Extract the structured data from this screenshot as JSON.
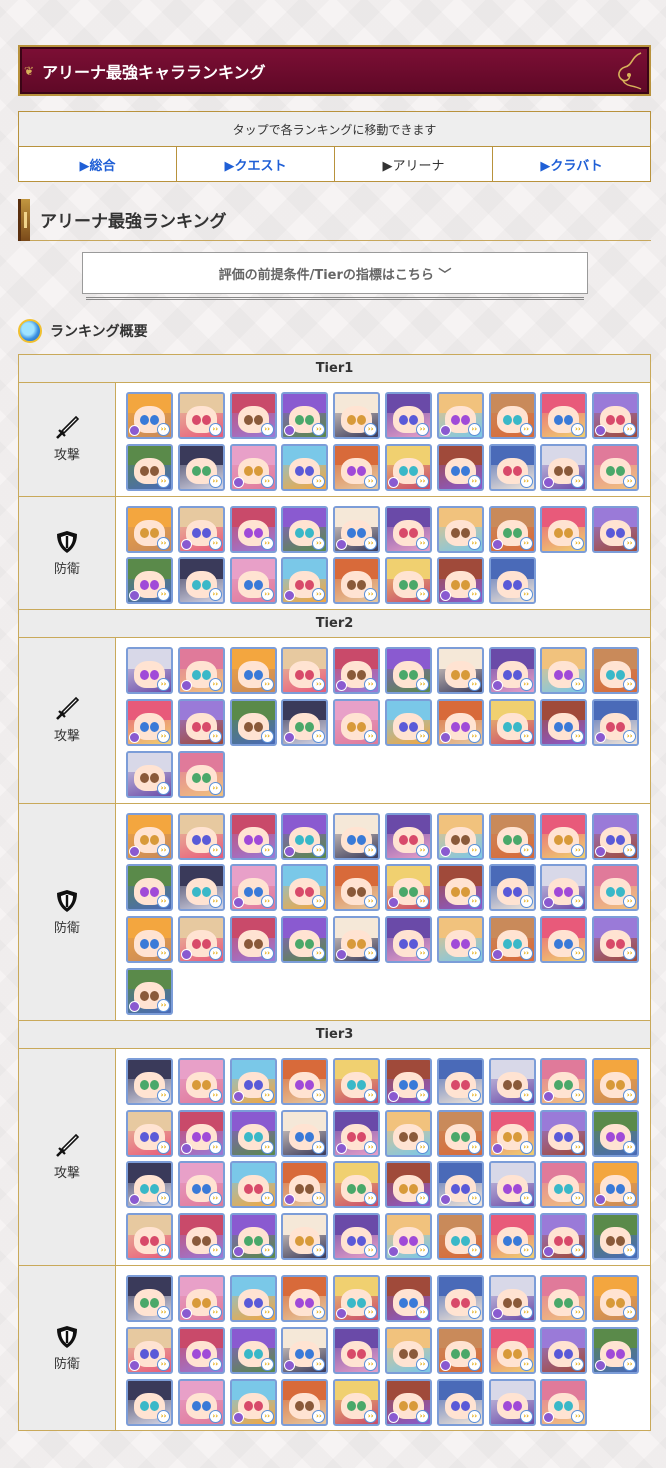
{
  "banner": {
    "title": "アリーナ最強キャラランキング"
  },
  "nav": {
    "header": "タップで各ランキングに移動できます",
    "tabs": [
      {
        "label": "▶総合",
        "current": false
      },
      {
        "label": "▶クエスト",
        "current": false
      },
      {
        "label": "▶アリーナ",
        "current": true
      },
      {
        "label": "▶クラバト",
        "current": false
      }
    ]
  },
  "section": {
    "title": "アリーナ最強ランキング"
  },
  "criteria": {
    "label": "評価の前提条件/Tierの指標はこちら ﹀"
  },
  "overview": {
    "title": "ランキング概要"
  },
  "roles": {
    "attack": "攻撃",
    "defense": "防衛"
  },
  "icons": {
    "attack": "sword-icon",
    "defense": "shield-icon"
  },
  "tiers": [
    {
      "name": "Tier1",
      "attack_count": 20,
      "defense_count": 18
    },
    {
      "name": "Tier2",
      "attack_count": 22,
      "defense_count": 31
    },
    {
      "name": "Tier3",
      "attack_count": 40,
      "defense_count": 29
    }
  ],
  "colors": {
    "banner_bg": "#6b0a2e",
    "accent_gold": "#b8923c",
    "link_blue": "#1f5fd6",
    "icon_border": "#7c9dd8"
  }
}
